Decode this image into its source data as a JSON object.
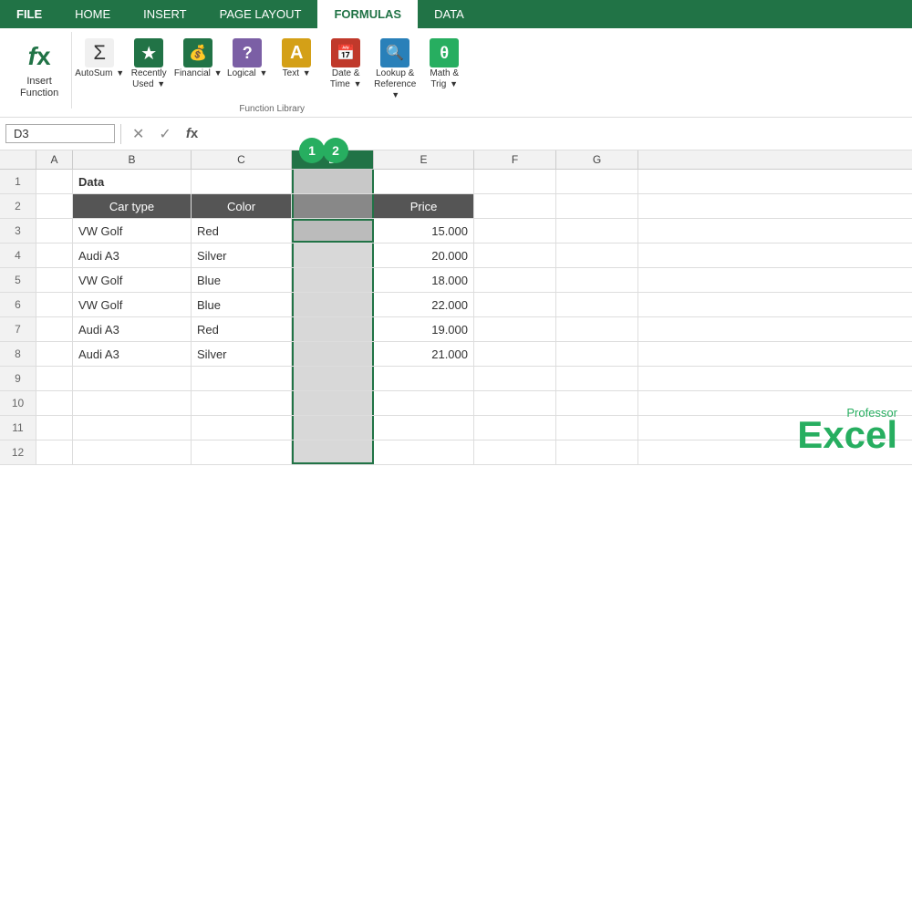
{
  "tabs": [
    {
      "id": "file",
      "label": "FILE",
      "active": false,
      "style": "file"
    },
    {
      "id": "home",
      "label": "HOME",
      "active": false
    },
    {
      "id": "insert",
      "label": "INSERT",
      "active": false
    },
    {
      "id": "page-layout",
      "label": "PAGE LAYOUT",
      "active": false
    },
    {
      "id": "formulas",
      "label": "FORMULAS",
      "active": true
    },
    {
      "id": "data",
      "label": "DATA",
      "active": false
    }
  ],
  "ribbon_groups": [
    {
      "id": "insert-function",
      "buttons": [
        {
          "id": "insert-fn",
          "label": "Insert\nFunction",
          "icon": "fx",
          "large": true
        }
      ],
      "group_label": ""
    },
    {
      "id": "function-library",
      "buttons": [
        {
          "id": "autosum",
          "label": "AutoSum",
          "icon": "Σ",
          "large": false,
          "has_dropdown": true,
          "icon_style": "autosum"
        },
        {
          "id": "recently-used",
          "label": "Recently\nUsed",
          "icon": "★",
          "large": false,
          "has_dropdown": true,
          "icon_style": "recently"
        },
        {
          "id": "financial",
          "label": "Financial",
          "icon": "💰",
          "large": false,
          "has_dropdown": true,
          "icon_style": "financial"
        },
        {
          "id": "logical",
          "label": "Logical",
          "icon": "?",
          "large": false,
          "has_dropdown": true,
          "icon_style": "logical"
        },
        {
          "id": "text",
          "label": "Text",
          "icon": "A",
          "large": false,
          "has_dropdown": true,
          "icon_style": "text"
        },
        {
          "id": "datetime",
          "label": "Date &\nTime",
          "icon": "📅",
          "large": false,
          "has_dropdown": true,
          "icon_style": "datetime"
        },
        {
          "id": "lookup",
          "label": "Lookup &\nReference",
          "icon": "🔍",
          "large": false,
          "has_dropdown": true,
          "icon_style": "lookup"
        },
        {
          "id": "math",
          "label": "Math &\nTrig",
          "icon": "θ",
          "large": false,
          "has_dropdown": true,
          "icon_style": "math"
        }
      ],
      "group_label": "Function Library"
    }
  ],
  "formula_bar": {
    "name_box": "D3",
    "cancel_label": "✕",
    "confirm_label": "✓",
    "fx_label": "fx"
  },
  "columns": [
    {
      "id": "a",
      "label": "A",
      "selected": false
    },
    {
      "id": "b",
      "label": "B",
      "selected": false
    },
    {
      "id": "c",
      "label": "C",
      "selected": false
    },
    {
      "id": "d",
      "label": "D",
      "selected": true
    },
    {
      "id": "e",
      "label": "E",
      "selected": false
    },
    {
      "id": "f",
      "label": "F",
      "selected": false
    },
    {
      "id": "g",
      "label": "G",
      "selected": false
    }
  ],
  "rows": [
    {
      "num": "1",
      "cells": [
        {
          "col": "a",
          "value": "",
          "style": ""
        },
        {
          "col": "b",
          "value": "Data",
          "style": "bold"
        },
        {
          "col": "c",
          "value": "",
          "style": ""
        },
        {
          "col": "d",
          "value": "",
          "style": "col-d"
        },
        {
          "col": "e",
          "value": "",
          "style": ""
        },
        {
          "col": "f",
          "value": "",
          "style": ""
        },
        {
          "col": "g",
          "value": "",
          "style": ""
        }
      ]
    },
    {
      "num": "2",
      "cells": [
        {
          "col": "a",
          "value": "",
          "style": ""
        },
        {
          "col": "b",
          "value": "Car type",
          "style": "header-cell"
        },
        {
          "col": "c",
          "value": "Color",
          "style": "header-cell"
        },
        {
          "col": "d",
          "value": "",
          "style": "col-d"
        },
        {
          "col": "e",
          "value": "Price",
          "style": "header-cell"
        },
        {
          "col": "f",
          "value": "",
          "style": ""
        },
        {
          "col": "g",
          "value": "",
          "style": ""
        }
      ]
    },
    {
      "num": "3",
      "cells": [
        {
          "col": "a",
          "value": "",
          "style": ""
        },
        {
          "col": "b",
          "value": "VW Golf",
          "style": ""
        },
        {
          "col": "c",
          "value": "Red",
          "style": ""
        },
        {
          "col": "d",
          "value": "",
          "style": "col-d selected-cell"
        },
        {
          "col": "e",
          "value": "15.000",
          "style": "price"
        },
        {
          "col": "f",
          "value": "",
          "style": ""
        },
        {
          "col": "g",
          "value": "",
          "style": ""
        }
      ]
    },
    {
      "num": "4",
      "cells": [
        {
          "col": "a",
          "value": "",
          "style": ""
        },
        {
          "col": "b",
          "value": "Audi A3",
          "style": ""
        },
        {
          "col": "c",
          "value": "Silver",
          "style": ""
        },
        {
          "col": "d",
          "value": "",
          "style": "col-d-light"
        },
        {
          "col": "e",
          "value": "20.000",
          "style": "price"
        },
        {
          "col": "f",
          "value": "",
          "style": ""
        },
        {
          "col": "g",
          "value": "",
          "style": ""
        }
      ]
    },
    {
      "num": "5",
      "cells": [
        {
          "col": "a",
          "value": "",
          "style": ""
        },
        {
          "col": "b",
          "value": "VW Golf",
          "style": ""
        },
        {
          "col": "c",
          "value": "Blue",
          "style": ""
        },
        {
          "col": "d",
          "value": "",
          "style": "col-d-light"
        },
        {
          "col": "e",
          "value": "18.000",
          "style": "price"
        },
        {
          "col": "f",
          "value": "",
          "style": ""
        },
        {
          "col": "g",
          "value": "",
          "style": ""
        }
      ]
    },
    {
      "num": "6",
      "cells": [
        {
          "col": "a",
          "value": "",
          "style": ""
        },
        {
          "col": "b",
          "value": "VW Golf",
          "style": ""
        },
        {
          "col": "c",
          "value": "Blue",
          "style": ""
        },
        {
          "col": "d",
          "value": "",
          "style": "col-d-light"
        },
        {
          "col": "e",
          "value": "22.000",
          "style": "price"
        },
        {
          "col": "f",
          "value": "",
          "style": ""
        },
        {
          "col": "g",
          "value": "",
          "style": ""
        }
      ]
    },
    {
      "num": "7",
      "cells": [
        {
          "col": "a",
          "value": "",
          "style": ""
        },
        {
          "col": "b",
          "value": "Audi A3",
          "style": ""
        },
        {
          "col": "c",
          "value": "Red",
          "style": ""
        },
        {
          "col": "d",
          "value": "",
          "style": "col-d-light"
        },
        {
          "col": "e",
          "value": "19.000",
          "style": "price"
        },
        {
          "col": "f",
          "value": "",
          "style": ""
        },
        {
          "col": "g",
          "value": "",
          "style": ""
        }
      ]
    },
    {
      "num": "8",
      "cells": [
        {
          "col": "a",
          "value": "",
          "style": ""
        },
        {
          "col": "b",
          "value": "Audi A3",
          "style": ""
        },
        {
          "col": "c",
          "value": "Silver",
          "style": ""
        },
        {
          "col": "d",
          "value": "",
          "style": "col-d-light"
        },
        {
          "col": "e",
          "value": "21.000",
          "style": "price"
        },
        {
          "col": "f",
          "value": "",
          "style": ""
        },
        {
          "col": "g",
          "value": "",
          "style": ""
        }
      ]
    },
    {
      "num": "9",
      "cells": [
        {
          "col": "a",
          "value": "",
          "style": ""
        },
        {
          "col": "b",
          "value": "",
          "style": ""
        },
        {
          "col": "c",
          "value": "",
          "style": ""
        },
        {
          "col": "d",
          "value": "",
          "style": "col-d-light"
        },
        {
          "col": "e",
          "value": "",
          "style": ""
        },
        {
          "col": "f",
          "value": "",
          "style": ""
        },
        {
          "col": "g",
          "value": "",
          "style": ""
        }
      ]
    },
    {
      "num": "10",
      "cells": [
        {
          "col": "a",
          "value": "",
          "style": ""
        },
        {
          "col": "b",
          "value": "",
          "style": ""
        },
        {
          "col": "c",
          "value": "",
          "style": ""
        },
        {
          "col": "d",
          "value": "",
          "style": "col-d-light"
        },
        {
          "col": "e",
          "value": "",
          "style": ""
        },
        {
          "col": "f",
          "value": "",
          "style": ""
        },
        {
          "col": "g",
          "value": "",
          "style": ""
        }
      ]
    },
    {
      "num": "11",
      "cells": [
        {
          "col": "a",
          "value": "",
          "style": ""
        },
        {
          "col": "b",
          "value": "",
          "style": ""
        },
        {
          "col": "c",
          "value": "",
          "style": ""
        },
        {
          "col": "d",
          "value": "",
          "style": "col-d-light"
        },
        {
          "col": "e",
          "value": "",
          "style": ""
        },
        {
          "col": "f",
          "value": "",
          "style": ""
        },
        {
          "col": "g",
          "value": "",
          "style": ""
        }
      ]
    },
    {
      "num": "12",
      "cells": [
        {
          "col": "a",
          "value": "",
          "style": ""
        },
        {
          "col": "b",
          "value": "",
          "style": ""
        },
        {
          "col": "c",
          "value": "",
          "style": ""
        },
        {
          "col": "d",
          "value": "",
          "style": "col-d-light"
        },
        {
          "col": "e",
          "value": "",
          "style": ""
        },
        {
          "col": "f",
          "value": "",
          "style": ""
        },
        {
          "col": "g",
          "value": "",
          "style": ""
        }
      ]
    }
  ],
  "annotations": {
    "circle1": "1",
    "circle2": "2"
  },
  "watermark": {
    "professor": "Professor",
    "excel": "Excel"
  }
}
